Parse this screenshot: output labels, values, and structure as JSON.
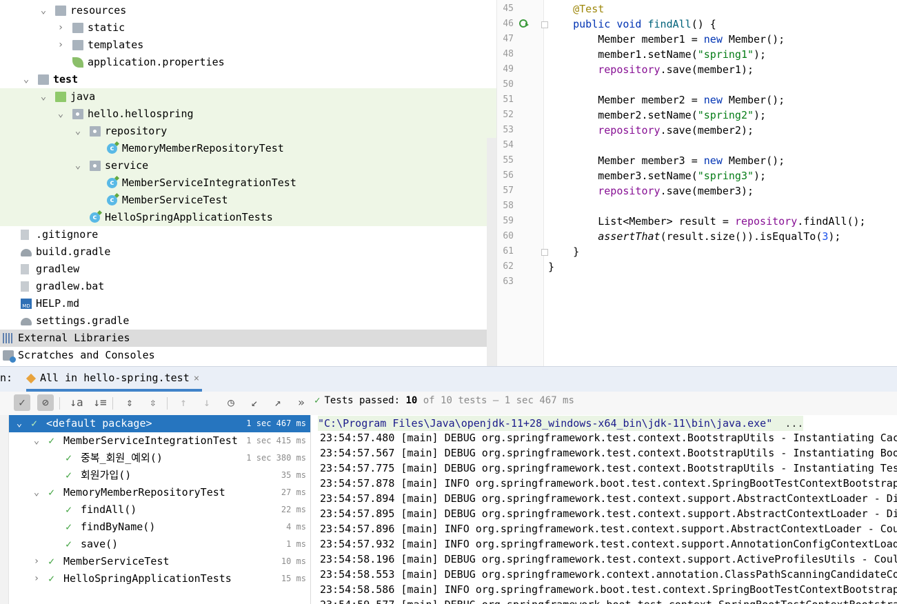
{
  "project_tree": {
    "items": [
      {
        "label": "resources",
        "depth": 2,
        "expanded": true,
        "icon": "resources-folder-icon",
        "highlight": "none",
        "bold": false
      },
      {
        "label": "static",
        "depth": 3,
        "expanded": false,
        "icon": "folder-icon",
        "highlight": "none",
        "bold": false
      },
      {
        "label": "templates",
        "depth": 3,
        "expanded": false,
        "icon": "folder-icon",
        "highlight": "none",
        "bold": false
      },
      {
        "label": "application.properties",
        "depth": 3,
        "icon": "spring-properties-icon",
        "highlight": "none",
        "bold": false
      },
      {
        "label": "test",
        "depth": 1,
        "expanded": true,
        "icon": "folder-icon",
        "highlight": "none",
        "bold": true
      },
      {
        "label": "java",
        "depth": 2,
        "expanded": true,
        "icon": "test-source-folder-icon",
        "highlight": "green",
        "bold": false
      },
      {
        "label": "hello.hellospring",
        "depth": 3,
        "expanded": true,
        "icon": "package-icon",
        "highlight": "green",
        "bold": false
      },
      {
        "label": "repository",
        "depth": 4,
        "expanded": true,
        "icon": "package-icon",
        "highlight": "green",
        "bold": false
      },
      {
        "label": "MemoryMemberRepositoryTest",
        "depth": 5,
        "icon": "test-class-icon",
        "highlight": "green",
        "bold": false
      },
      {
        "label": "service",
        "depth": 4,
        "expanded": true,
        "icon": "package-icon",
        "highlight": "green",
        "bold": false
      },
      {
        "label": "MemberServiceIntegrationTest",
        "depth": 5,
        "icon": "test-class-icon",
        "highlight": "green",
        "bold": false
      },
      {
        "label": "MemberServiceTest",
        "depth": 5,
        "icon": "test-class-icon",
        "highlight": "green",
        "bold": false
      },
      {
        "label": "HelloSpringApplicationTests",
        "depth": 4,
        "icon": "test-class-icon",
        "highlight": "green",
        "bold": false
      },
      {
        "label": ".gitignore",
        "depth": 0,
        "icon": "gitignore-file-icon",
        "highlight": "none",
        "bold": false
      },
      {
        "label": "build.gradle",
        "depth": 0,
        "icon": "gradle-icon",
        "highlight": "none",
        "bold": false
      },
      {
        "label": "gradlew",
        "depth": 0,
        "icon": "shell-script-icon",
        "highlight": "none",
        "bold": false
      },
      {
        "label": "gradlew.bat",
        "depth": 0,
        "icon": "batch-file-icon",
        "highlight": "none",
        "bold": false
      },
      {
        "label": "HELP.md",
        "depth": 0,
        "icon": "markdown-file-icon",
        "highlight": "none",
        "bold": false
      },
      {
        "label": "settings.gradle",
        "depth": 0,
        "icon": "gradle-icon",
        "highlight": "none",
        "bold": false
      },
      {
        "label": "External Libraries",
        "depth": -1,
        "expanded": false,
        "icon": "libraries-icon",
        "highlight": "gray",
        "bold": false
      },
      {
        "label": "Scratches and Consoles",
        "depth": -1,
        "expanded": false,
        "icon": "scratches-icon",
        "highlight": "none",
        "bold": false
      }
    ]
  },
  "editor": {
    "lines": [
      {
        "n": "45",
        "html": "    <span class=\"ann\">@Test</span>"
      },
      {
        "n": "46",
        "html": "    <span class=\"kw\">public void</span> <span class=\"fn\">findAll</span>() {"
      },
      {
        "n": "47",
        "html": "        Member member1 = <span class=\"kw\">new</span> Member();"
      },
      {
        "n": "48",
        "html": "        member1.setName(<span class=\"str\">\"spring1\"</span>);"
      },
      {
        "n": "49",
        "html": "        <span class=\"fld\">repository</span>.save(member1);"
      },
      {
        "n": "50",
        "html": ""
      },
      {
        "n": "51",
        "html": "        Member member2 = <span class=\"kw\">new</span> Member();"
      },
      {
        "n": "52",
        "html": "        member2.setName(<span class=\"str\">\"spring2\"</span>);"
      },
      {
        "n": "53",
        "html": "        <span class=\"fld\">repository</span>.save(member2);"
      },
      {
        "n": "54",
        "html": ""
      },
      {
        "n": "55",
        "html": "        Member member3 = <span class=\"kw\">new</span> Member();"
      },
      {
        "n": "56",
        "html": "        member3.setName(<span class=\"str\">\"spring3\"</span>);"
      },
      {
        "n": "57",
        "html": "        <span class=\"fld\">repository</span>.save(member3);"
      },
      {
        "n": "58",
        "html": ""
      },
      {
        "n": "59",
        "html": "        List&lt;Member&gt; result = <span class=\"fld\">repository</span>.findAll();"
      },
      {
        "n": "60",
        "html": "        <span class=\"it\">assertThat</span>(result.size()).isEqualTo(<span class=\"num\">3</span>);"
      },
      {
        "n": "61",
        "html": "    }"
      },
      {
        "n": "62",
        "html": "}"
      },
      {
        "n": "63",
        "html": ""
      }
    ]
  },
  "run_panel": {
    "label": "n:",
    "tab_label": "All in hello-spring.test",
    "tab_close": "×",
    "status": {
      "prefix": "Tests passed:",
      "passed": "10",
      "of_total": "of 10 tests",
      "time": "– 1 sec 467 ms"
    },
    "toolbar": [
      {
        "name": "show-passed-toggle",
        "glyph": "✓",
        "on": true
      },
      {
        "name": "show-ignored-toggle",
        "glyph": "⊘",
        "on": true
      },
      {
        "name": "sort-alphabetically-button",
        "glyph": "↓a",
        "on": false
      },
      {
        "name": "sort-by-duration-button",
        "glyph": "↓≡",
        "on": false
      },
      {
        "name": "expand-all-button",
        "glyph": "⇕",
        "on": false
      },
      {
        "name": "collapse-all-button",
        "glyph": "⇳",
        "on": false
      },
      {
        "name": "previous-failed-test-button",
        "glyph": "↑",
        "dim": true
      },
      {
        "name": "next-failed-test-button",
        "glyph": "↓",
        "dim": true
      },
      {
        "name": "test-history-button",
        "glyph": "◷",
        "on": false
      },
      {
        "name": "import-tests-button",
        "glyph": "↙",
        "on": false
      },
      {
        "name": "export-tests-button",
        "glyph": "↗",
        "on": false
      },
      {
        "name": "more-actions-button",
        "glyph": "»",
        "on": false
      }
    ]
  },
  "test_tree": {
    "items": [
      {
        "label": "<default package>",
        "depth": 0,
        "expanded": true,
        "duration": "1 sec 467 ms",
        "selected": true
      },
      {
        "label": "MemberServiceIntegrationTest",
        "depth": 1,
        "expanded": true,
        "duration": "1 sec 415 ms",
        "selected": false
      },
      {
        "label": "중복_회원_예외()",
        "depth": 2,
        "duration": "1 sec 380 ms",
        "selected": false
      },
      {
        "label": "회원가입()",
        "depth": 2,
        "duration": "35 ms",
        "selected": false
      },
      {
        "label": "MemoryMemberRepositoryTest",
        "depth": 1,
        "expanded": true,
        "duration": "27 ms",
        "selected": false
      },
      {
        "label": "findAll()",
        "depth": 2,
        "duration": "22 ms",
        "selected": false
      },
      {
        "label": "findByName()",
        "depth": 2,
        "duration": "4 ms",
        "selected": false
      },
      {
        "label": "save()",
        "depth": 2,
        "duration": "1 ms",
        "selected": false
      },
      {
        "label": "MemberServiceTest",
        "depth": 1,
        "expanded": false,
        "duration": "10 ms",
        "selected": false
      },
      {
        "label": "HelloSpringApplicationTests",
        "depth": 1,
        "expanded": false,
        "duration": "15 ms",
        "selected": false
      }
    ]
  },
  "console": {
    "command": "\"C:\\Program Files\\Java\\openjdk-11+28_windows-x64_bin\\jdk-11\\bin\\java.exe\"",
    "command_ellipsis": "...",
    "lines": [
      "23:54:57.480 [main] DEBUG org.springframework.test.context.BootstrapUtils - Instantiating Cac",
      "23:54:57.567 [main] DEBUG org.springframework.test.context.BootstrapUtils - Instantiating Boo",
      "23:54:57.775 [main] DEBUG org.springframework.test.context.BootstrapUtils - Instantiating Tes",
      "23:54:57.878 [main] INFO org.springframework.boot.test.context.SpringBootTestContextBootstrap",
      "23:54:57.894 [main] DEBUG org.springframework.test.context.support.AbstractContextLoader - Di",
      "23:54:57.895 [main] DEBUG org.springframework.test.context.support.AbstractContextLoader - Di",
      "23:54:57.896 [main] INFO org.springframework.test.context.support.AbstractContextLoader - Cou",
      "23:54:57.932 [main] INFO org.springframework.test.context.support.AnnotationConfigContextLoad",
      "23:54:58.196 [main] DEBUG org.springframework.test.context.support.ActiveProfilesUtils - Coul",
      "23:54:58.553 [main] DEBUG org.springframework.context.annotation.ClassPathScanningCandidateCo",
      "23:54:58.586 [main] INFO org.springframework.boot.test.context.SpringBootTestContextBootstrap",
      "23:54:59.577 [main] DEBUG org.springframework.boot.test.context.SpringBootTestContextBootstra"
    ]
  },
  "colors": {
    "selection": "#2675bf",
    "test_highlight": "#eef6e6",
    "pass_green": "#44a544",
    "tab_underline": "#4083c9"
  }
}
